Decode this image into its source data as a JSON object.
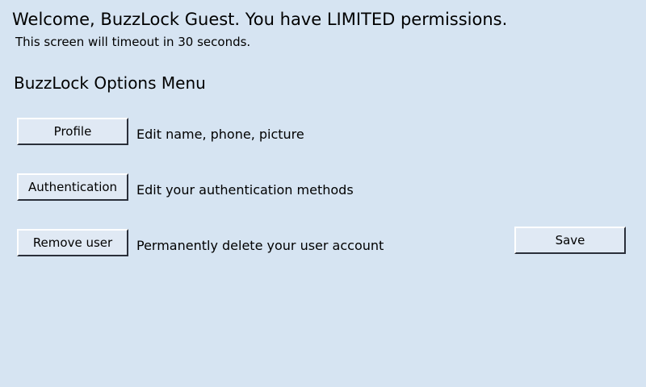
{
  "header": {
    "welcome": "Welcome, BuzzLock Guest. You have LIMITED permissions.",
    "timeout": "This screen will timeout in 30 seconds."
  },
  "menu": {
    "title": "BuzzLock Options Menu",
    "items": [
      {
        "label": "Profile",
        "description": "Edit name, phone, picture"
      },
      {
        "label": "Authentication",
        "description": "Edit your authentication methods"
      },
      {
        "label": "Remove user",
        "description": "Permanently delete your user account"
      }
    ]
  },
  "actions": {
    "save_label": "Save"
  },
  "colors": {
    "background": "#d6e4f2",
    "button_face": "#e0e9f4"
  }
}
